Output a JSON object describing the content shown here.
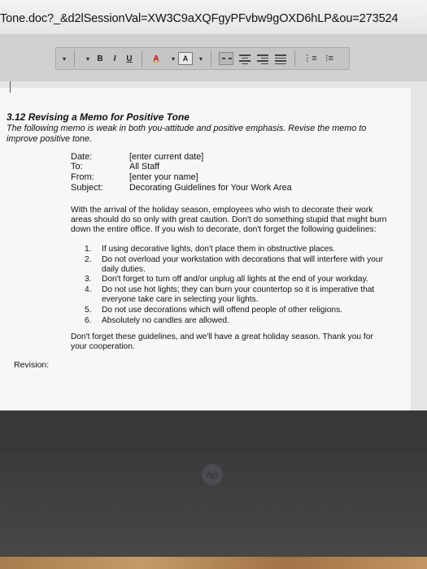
{
  "browser": {
    "url_text": "Tone.doc?_&d2lSessionVal=XW3C9aXQFgyPFvbw9gOXD6hLP&ou=273524"
  },
  "toolbar": {
    "bold_label": "B",
    "italic_label": "I",
    "underline_label": "U",
    "font_color_label": "A",
    "highlight_label": "A",
    "dropdown_arrow": "▾"
  },
  "document": {
    "title": "3.12 Revising a Memo for Positive Tone",
    "instructions": "The following memo is weak in both you-attitude and positive emphasis. Revise the memo to improve positive tone.",
    "memo_header": [
      {
        "label": "Date:",
        "value": "[enter current date]"
      },
      {
        "label": "To:",
        "value": "All Staff"
      },
      {
        "label": "From:",
        "value": "[enter your name]"
      },
      {
        "label": "Subject:",
        "value": "Decorating Guidelines for Your Work Area"
      }
    ],
    "intro_paragraph": "With the arrival of the holiday season, employees who wish to decorate their work areas should do so only with great caution. Don't do something stupid that might burn down the entire office. If you wish to decorate, don't forget the following guidelines:",
    "guidelines": [
      {
        "num": "1.",
        "text": "If using decorative lights, don't place them in obstructive places."
      },
      {
        "num": "2.",
        "text": "Do not overload your workstation with decorations that will interfere with your daily duties."
      },
      {
        "num": "3.",
        "text": "Don't forget to turn off and/or unplug all lights at the end of your workday."
      },
      {
        "num": "4.",
        "text": "Do not use hot lights; they can burn your countertop so it is imperative that everyone take care in selecting your lights."
      },
      {
        "num": "5.",
        "text": "Do not use decorations which will offend people of other religions."
      },
      {
        "num": "6.",
        "text": "Absolutely no candles are allowed."
      }
    ],
    "closing": "Don't forget these guidelines, and we'll have a great holiday season. Thank you for your cooperation.",
    "revision_label": "Revision:"
  },
  "laptop": {
    "logo_text": "hp"
  }
}
